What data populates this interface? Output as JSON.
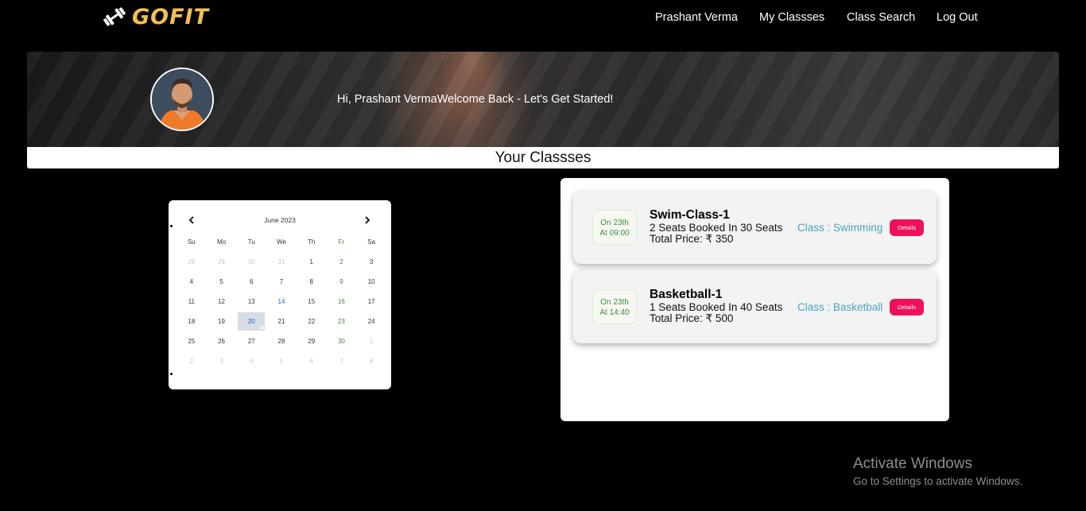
{
  "brand": {
    "name": "GOFIT",
    "color": "#f2c14e",
    "icon": "dumbbell-icon"
  },
  "nav": {
    "items": [
      {
        "label": "Prashant Verma"
      },
      {
        "label": "My Classses"
      },
      {
        "label": "Class Search"
      },
      {
        "label": "Log Out"
      }
    ]
  },
  "hero": {
    "greeting": "Hi, Prashant VermaWelcome Back - Let's Get Started!",
    "avatar": "user-avatar"
  },
  "section": {
    "title": "Your Classses"
  },
  "calendar": {
    "month_label": "June 2023",
    "prev_icon": "chevron-left-icon",
    "next_icon": "chevron-right-icon",
    "weekdays": [
      "Su",
      "Mo",
      "Tu",
      "We",
      "Th",
      "Fr",
      "Sa"
    ],
    "weeks": [
      [
        "28",
        "29",
        "30",
        "31",
        "1",
        "2",
        "3"
      ],
      [
        "4",
        "5",
        "6",
        "7",
        "8",
        "9",
        "10"
      ],
      [
        "11",
        "12",
        "13",
        "14",
        "15",
        "16",
        "17"
      ],
      [
        "18",
        "19",
        "20",
        "21",
        "22",
        "23",
        "24"
      ],
      [
        "25",
        "26",
        "27",
        "28",
        "29",
        "30",
        "1"
      ],
      [
        "2",
        "3",
        "4",
        "5",
        "6",
        "7",
        "8"
      ]
    ],
    "selected_day": "20",
    "today_day": "14"
  },
  "classes": [
    {
      "date_line1": "On 23th",
      "date_line2": "At 09:00",
      "name": "Swim-Class-1",
      "seats": "2 Seats Booked In 30 Seats",
      "price": "Total Price: ₹ 350",
      "type": "Class : Swimming",
      "button": "Details"
    },
    {
      "date_line1": "On 23th",
      "date_line2": "At 14:40",
      "name": "Basketball-1",
      "seats": "1 Seats Booked In 40 Seats",
      "price": "Total Price: ₹ 500",
      "type": "Class : Basketball",
      "button": "Details"
    }
  ],
  "colors": {
    "accent_button": "#f0105a",
    "class_type": "#4aa3c0",
    "date_badge_text": "#3e8e3e"
  },
  "watermark": {
    "title": "Activate Windows",
    "subtitle": "Go to Settings to activate Windows."
  }
}
